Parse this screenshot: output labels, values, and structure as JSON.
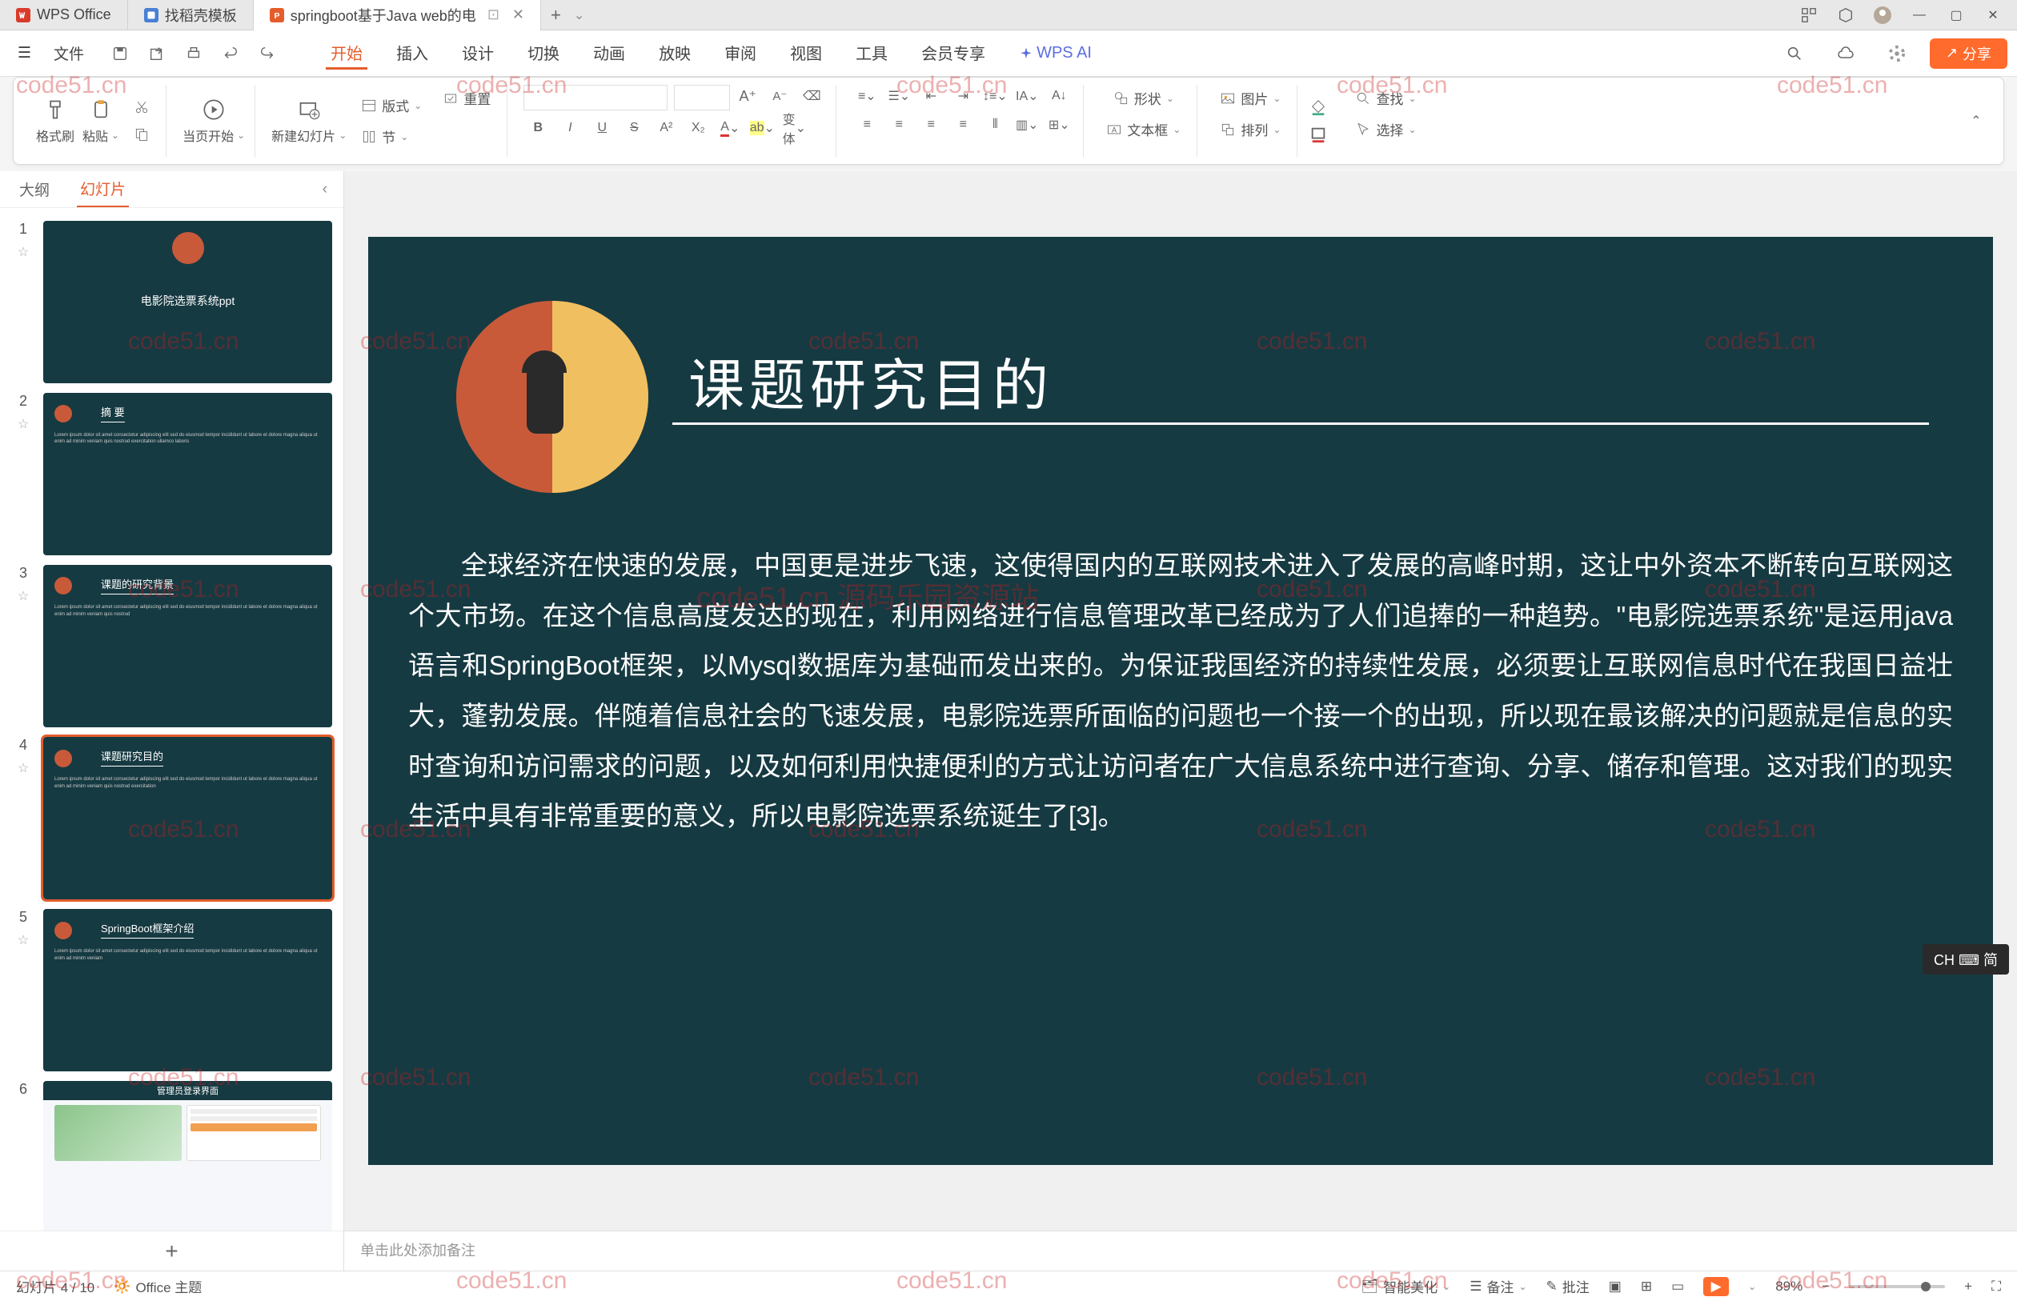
{
  "tabs": {
    "app": "WPS Office",
    "tab1": "找稻壳模板",
    "tab2": "springboot基于Java web的电",
    "add": "+"
  },
  "topMenu": {
    "file": "文件",
    "items": [
      "开始",
      "插入",
      "设计",
      "切换",
      "动画",
      "放映",
      "审阅",
      "视图",
      "工具",
      "会员专享"
    ],
    "ai": "WPS AI",
    "share": "分享"
  },
  "ribbon": {
    "formatPainter": "格式刷",
    "paste": "粘贴",
    "fromCurrent": "当页开始",
    "newSlide": "新建幻灯片",
    "layout": "版式",
    "section": "节",
    "reset": "重置",
    "bianti": "变体",
    "shape": "形状",
    "textbox": "文本框",
    "picture": "图片",
    "arrange": "排列",
    "find": "查找",
    "select": "选择"
  },
  "sidePanel": {
    "outline": "大纲",
    "slides": "幻灯片"
  },
  "thumbnails": [
    {
      "num": "1",
      "title": "电影院选票系统ppt"
    },
    {
      "num": "2",
      "title": "摘 要"
    },
    {
      "num": "3",
      "title": "课题的研究背景"
    },
    {
      "num": "4",
      "title": "课题研究目的"
    },
    {
      "num": "5",
      "title": "SpringBoot框架介绍"
    },
    {
      "num": "6",
      "title": "管理员登录界面"
    }
  ],
  "currentSlide": {
    "title": "课题研究目的",
    "body": "全球经济在快速的发展，中国更是进步飞速，这使得国内的互联网技术进入了发展的高峰时期，这让中外资本不断转向互联网这个大市场。在这个信息高度发达的现在，利用网络进行信息管理改革已经成为了人们追捧的一种趋势。\"电影院选票系统\"是运用java语言和SpringBoot框架，以Mysql数据库为基础而发出来的。为保证我国经济的持续性发展，必须要让互联网信息时代在我国日益壮大，蓬勃发展。伴随着信息社会的飞速发展，电影院选票所面临的问题也一个接一个的出现，所以现在最该解决的问题就是信息的实时查询和访问需求的问题，以及如何利用快捷便利的方式让访问者在广大信息系统中进行查询、分享、储存和管理。这对我们的现实生活中具有非常重要的意义，所以电影院选票系统诞生了[3]。"
  },
  "notes": "单击此处添加备注",
  "statusBar": {
    "slideCount": "幻灯片 4 / 10",
    "theme": "Office 主题",
    "smartBeautify": "智能美化",
    "notes": "备注",
    "comments": "批注",
    "zoom": "89%"
  },
  "ime": "CH ⌨ 简",
  "watermark": {
    "text": "code51.cn",
    "centerText": "code51.cn 源码乐园资源站"
  }
}
